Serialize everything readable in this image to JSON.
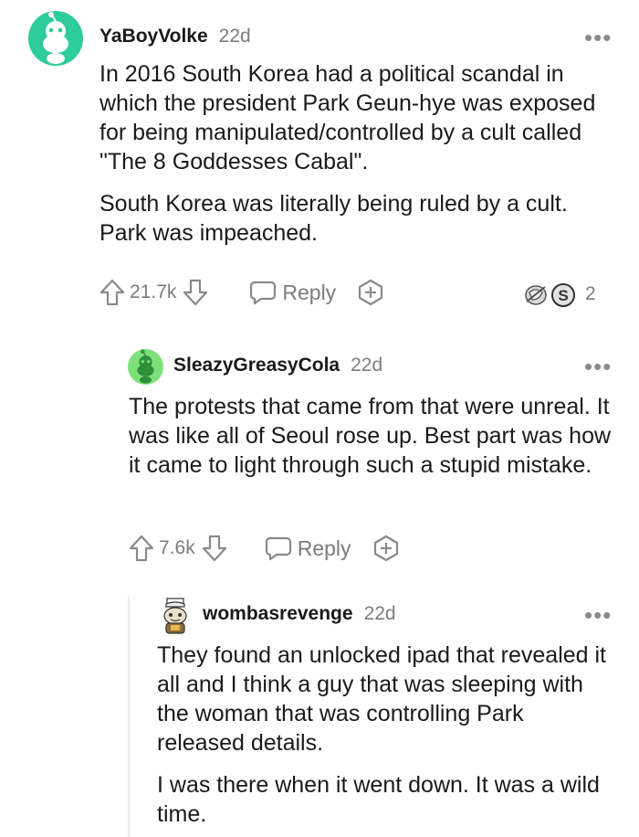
{
  "comments": [
    {
      "username": "YaBoyVolke",
      "age": "22d",
      "paragraphs": [
        "In 2016 South Korea had a political scandal in which the president Park Geun-hye was exposed for being manipulated/controlled by a cult called \"The 8 Goddesses Cabal\".",
        "South Korea was literally being ruled by a cult. Park was impeached."
      ],
      "votes": "21.7k",
      "reply_label": "Reply",
      "awards_count": "2",
      "avatar_color": "#2ecc9a"
    },
    {
      "username": "SleazyGreasyCola",
      "age": "22d",
      "paragraphs": [
        "The protests that came from that were unreal. It was like all of Seoul rose up. Best part was how it came to light through such a stupid mistake."
      ],
      "votes": "7.6k",
      "reply_label": "Reply",
      "avatar_color": "#7ee07a"
    },
    {
      "username": "wombasrevenge",
      "age": "22d",
      "paragraphs": [
        "They found an unlocked ipad that revealed it all and I think a guy that was sleeping with the woman that was controlling Park released details.",
        "I was there when it went down. It was a wild time."
      ]
    }
  ],
  "more_label": "•••",
  "icons": {
    "upvote": "upvote-icon",
    "downvote": "downvote-icon",
    "reply": "reply-icon",
    "award": "award-icon",
    "more": "more-options-icon"
  }
}
